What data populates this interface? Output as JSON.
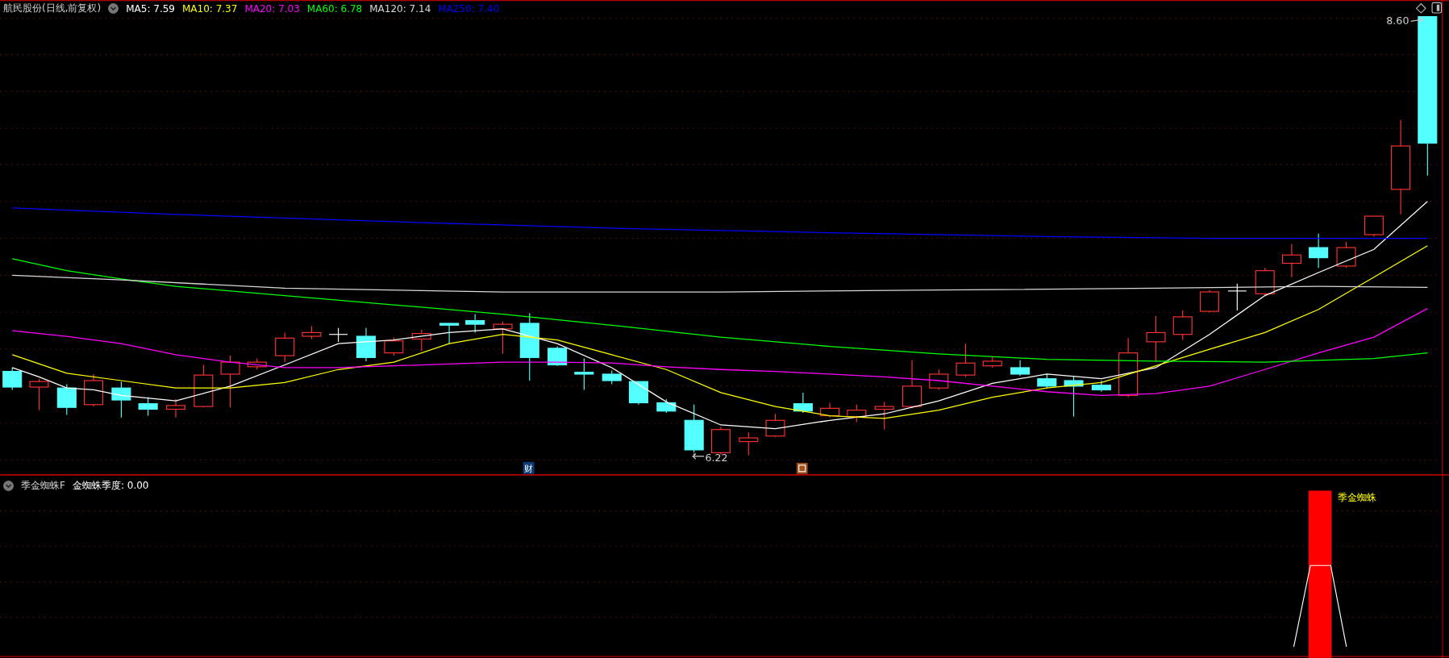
{
  "chart_title": {
    "stock": "航民股份(日线,前复权)"
  },
  "ma_legend": [
    {
      "label": "MA5: 7.59",
      "color": "#ffffff"
    },
    {
      "label": "MA10: 7.37",
      "color": "#ffff00"
    },
    {
      "label": "MA20: 7.03",
      "color": "#ff00ff"
    },
    {
      "label": "MA60: 6.78",
      "color": "#00ff00"
    },
    {
      "label": "MA120: 7.14",
      "color": "#d8d8d8"
    },
    {
      "label": "MA250: 7.40",
      "color": "#0000ff"
    }
  ],
  "main_chart": {
    "high_label": "8.60",
    "low_label": "6.22",
    "event_marker": "财"
  },
  "indicator_panel": {
    "name": "季金蜘蛛F",
    "reading": "金蜘蛛季度: 0.00",
    "signal_label": "季金蜘蛛"
  }
}
